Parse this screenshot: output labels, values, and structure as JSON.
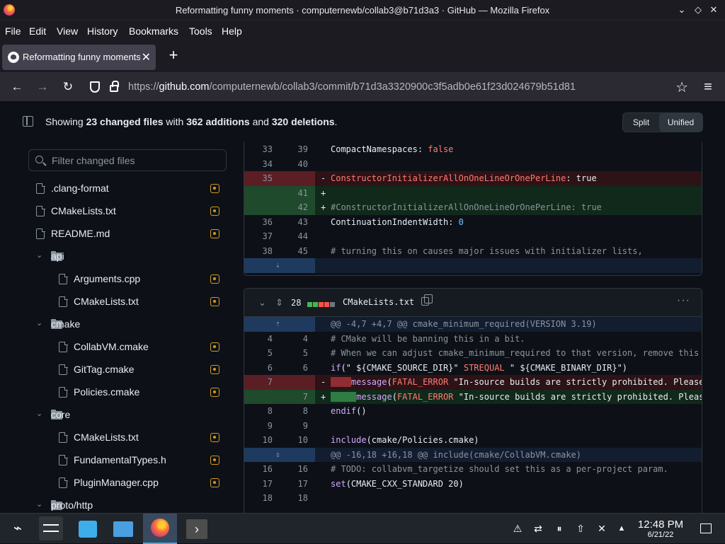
{
  "window": {
    "title": "Reformatting funny moments · computernewb/collab3@b71d3a3 · GitHub — Mozilla Firefox"
  },
  "menu": [
    "File",
    "Edit",
    "View",
    "History",
    "Bookmarks",
    "Tools",
    "Help"
  ],
  "tab": {
    "label": "Reformatting funny moments",
    "close": "✕",
    "new": "+"
  },
  "nav": {
    "url_prefix": "https://",
    "url_host": "github.com",
    "url_path": "/computernewb/collab3/commit/b71d3a3320900c3f5adb0e61f23d024679b51d81"
  },
  "summary": {
    "showing": "Showing ",
    "changed": "23 changed files",
    "with": " with ",
    "additions": "362 additions",
    "and": " and ",
    "deletions": "320 deletions",
    "end": ".",
    "split": "Split",
    "unified": "Unified"
  },
  "filter": {
    "placeholder": "Filter changed files"
  },
  "tree": [
    {
      "type": "file",
      "name": ".clang-format",
      "depth": 0,
      "modified": true
    },
    {
      "type": "file",
      "name": "CMakeLists.txt",
      "depth": 0,
      "modified": true
    },
    {
      "type": "file",
      "name": "README.md",
      "depth": 0,
      "modified": true
    },
    {
      "type": "folder",
      "name": "api",
      "depth": 0
    },
    {
      "type": "file",
      "name": "Arguments.cpp",
      "depth": 1,
      "modified": true
    },
    {
      "type": "file",
      "name": "CMakeLists.txt",
      "depth": 1,
      "modified": true
    },
    {
      "type": "folder",
      "name": "cmake",
      "depth": 0
    },
    {
      "type": "file",
      "name": "CollabVM.cmake",
      "depth": 1,
      "modified": true
    },
    {
      "type": "file",
      "name": "GitTag.cmake",
      "depth": 1,
      "modified": true
    },
    {
      "type": "file",
      "name": "Policies.cmake",
      "depth": 1,
      "modified": true
    },
    {
      "type": "folder",
      "name": "core",
      "depth": 0
    },
    {
      "type": "file",
      "name": "CMakeLists.txt",
      "depth": 1,
      "modified": true
    },
    {
      "type": "file",
      "name": "FundamentalTypes.h",
      "depth": 1,
      "modified": true
    },
    {
      "type": "file",
      "name": "PluginManager.cpp",
      "depth": 1,
      "modified": true
    },
    {
      "type": "folder",
      "name": "proto/http",
      "depth": 0
    }
  ],
  "diff1": {
    "rows": [
      {
        "kind": "ctx",
        "l": "33",
        "r": "39",
        "html": "CompactNamespaces: <span class=\"kw\">false</span>"
      },
      {
        "kind": "ctx",
        "l": "34",
        "r": "40",
        "html": ""
      },
      {
        "kind": "del",
        "l": "35",
        "r": "",
        "sign": "-",
        "html": "<span class=\"kw\">ConstructorInitializerAllOnOneLineOrOnePerLine</span>: true"
      },
      {
        "kind": "add",
        "l": "",
        "r": "41",
        "sign": "+",
        "html": ""
      },
      {
        "kind": "add",
        "l": "",
        "r": "42",
        "sign": "+",
        "html": "<span class=\"cm\">#ConstructorInitializerAllOnOneLineOrOnePerLine: true</span>"
      },
      {
        "kind": "ctx",
        "l": "36",
        "r": "43",
        "html": "ContinuationIndentWidth: <span class=\"num\">0</span>"
      },
      {
        "kind": "ctx",
        "l": "37",
        "r": "44",
        "html": ""
      },
      {
        "kind": "ctx",
        "l": "38",
        "r": "45",
        "html": "<span class=\"cm\"># turning this on causes major issues with initializer lists,</span>"
      },
      {
        "kind": "hunk",
        "l": "",
        "r": "",
        "expand": "⇣",
        "html": ""
      }
    ]
  },
  "file2": {
    "count": "28",
    "name": "CMakeLists.txt",
    "more": "···",
    "bars": [
      "#3fb950",
      "#3fb950",
      "#f85149",
      "#f85149",
      "#6e7681"
    ]
  },
  "diff2": {
    "rows": [
      {
        "kind": "hunk",
        "l": "",
        "r": "",
        "expand": "⇡",
        "html": "@@ -4,7 +4,7 @@ cmake_minimum_required(VERSION 3.19)"
      },
      {
        "kind": "ctx",
        "l": "4",
        "r": "4",
        "html": "<span class=\"cm\"># CMake will be banning this in a bit.</span>"
      },
      {
        "kind": "ctx",
        "l": "5",
        "r": "5",
        "html": "<span class=\"cm\"># When we can adjust cmake_minimum_required to that version, remove this</span>"
      },
      {
        "kind": "ctx",
        "l": "6",
        "r": "6",
        "html": "<span class=\"fn\">if</span>(\" ${CMAKE_SOURCE_DIR}\" <span class=\"kw\">STREQUAL</span> \" ${CMAKE_BINARY_DIR}\")"
      },
      {
        "kind": "del",
        "l": "7",
        "r": "",
        "sign": "-",
        "html": "<span class=\"wsdel\">    </span><span class=\"fn\">message</span>(<span class=\"kw\">FATAL_ERROR</span> \"In-source builds are strictly prohibited. Please"
      },
      {
        "kind": "add",
        "l": "",
        "r": "7",
        "sign": "+",
        "html": "<span class=\"wsadd\">     </span><span class=\"fn\">message</span>(<span class=\"kw\">FATAL_ERROR</span> \"In-source builds are strictly prohibited. Please"
      },
      {
        "kind": "ctx",
        "l": "8",
        "r": "8",
        "html": "<span class=\"fn\">endif</span>()"
      },
      {
        "kind": "ctx",
        "l": "9",
        "r": "9",
        "html": ""
      },
      {
        "kind": "ctx",
        "l": "10",
        "r": "10",
        "html": "<span class=\"fn\">include</span>(cmake/Policies.cmake)"
      },
      {
        "kind": "hunk",
        "l": "",
        "r": "",
        "expand": "⇕",
        "html": "@@ -16,18 +16,18 @@ include(cmake/CollabVM.cmake)"
      },
      {
        "kind": "ctx",
        "l": "16",
        "r": "16",
        "html": "<span class=\"cm\"># TODO: collabvm_targetize should set this as a per-project param.</span>"
      },
      {
        "kind": "ctx",
        "l": "17",
        "r": "17",
        "html": "<span class=\"fn\">set</span>(CMAKE_CXX_STANDARD 20)"
      },
      {
        "kind": "ctx",
        "l": "18",
        "r": "18",
        "html": ""
      }
    ]
  },
  "taskbar": {
    "time": "12:48 PM",
    "date": "6/21/22"
  }
}
